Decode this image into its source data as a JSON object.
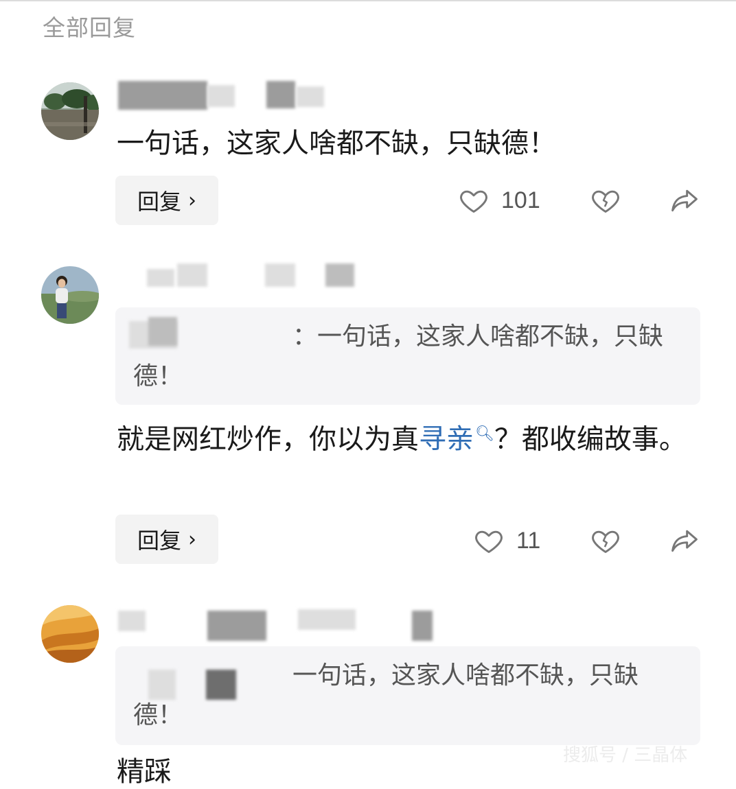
{
  "header": {
    "title": "全部回复"
  },
  "comments": [
    {
      "text": "一句话，这家人啥都不缺，只缺德！",
      "reply_label": "回复",
      "likes": "101"
    },
    {
      "quote": "：一句话，这家人啥都不缺，只缺德！",
      "text_before": "就是网红炒作，你以为真",
      "hashtag": "寻亲",
      "text_after": "？都收编故事。",
      "reply_label": "回复",
      "likes": "11"
    },
    {
      "quote": "一句话，这家人啥都不缺，只缺德！"
    }
  ],
  "next_comment_partial": "精踩",
  "watermark": "搜狐号 / 三晶体",
  "icons": {
    "like": "heart-outline-icon",
    "dislike": "broken-heart-icon",
    "share": "share-arrow-icon",
    "hashtag_search": "search-icon"
  }
}
